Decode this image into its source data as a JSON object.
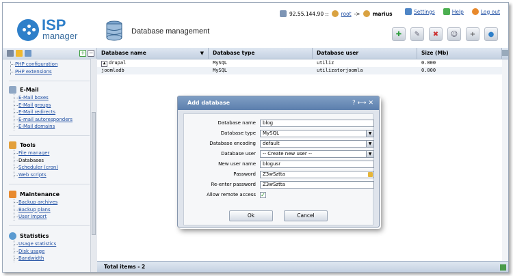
{
  "header": {
    "logo_isp": "ISP",
    "logo_manager": "manager",
    "page_title": "Database management",
    "ip": "92.55.144.90 ::",
    "user_root": "root",
    "arrow": "->",
    "user_current": "marius",
    "links": {
      "settings": "Settings",
      "help": "Help",
      "logout": "Log out"
    }
  },
  "sidebar": {
    "top_items": [
      "PHP configuration",
      "PHP extensions"
    ],
    "sections": [
      {
        "title": "E-Mail",
        "items": [
          "E-Mail boxes",
          "E-Mail groups",
          "E-Mail redirects",
          "E-mail autoresponders",
          "E-Mail domains"
        ]
      },
      {
        "title": "Tools",
        "items": [
          "File manager",
          "Databases",
          "Scheduler (cron)",
          "Web scripts"
        ]
      },
      {
        "title": "Maintenance",
        "items": [
          "Backup archives",
          "Backup plans",
          "User import"
        ]
      },
      {
        "title": "Statistics",
        "items": [
          "Usage statistics",
          "Disk usage",
          "Bandwidth"
        ]
      }
    ]
  },
  "table": {
    "columns": [
      "Database name",
      "Database type",
      "Database user",
      "Size (Mb)"
    ],
    "rows": [
      [
        "drupal",
        "MySQL",
        "utiliz",
        "0.000"
      ],
      [
        "joomladb",
        "MySQL",
        "utilizatorjoomla",
        "0.000"
      ]
    ],
    "footer": "Total items - 2"
  },
  "dialog": {
    "title": "Add database",
    "controls": "? ⟷ ✕",
    "fields": {
      "db_name_label": "Database name",
      "db_name_value": "blog",
      "db_type_label": "Database type",
      "db_type_value": "MySQL",
      "db_encoding_label": "Database encoding",
      "db_encoding_value": "default",
      "db_user_label": "Database user",
      "db_user_value": "-- Create new user --",
      "new_user_label": "New user name",
      "new_user_value": "blogusr",
      "password_label": "Password",
      "password_value": "Z3wSztta",
      "reenter_label": "Re-enter password",
      "reenter_value": "Z3wSztta",
      "remote_label": "Allow remote access",
      "remote_checked": "✓"
    },
    "ok_label": "Ok",
    "cancel_label": "Cancel"
  },
  "colors": {
    "accent": "#2e7fc9",
    "dialog_title": "#5c7fad",
    "link": "#1f4fa3"
  },
  "icons": [
    "logo-icon",
    "database-icon",
    "server-icon",
    "user-icon",
    "settings-icon",
    "help-icon",
    "logout-icon"
  ]
}
